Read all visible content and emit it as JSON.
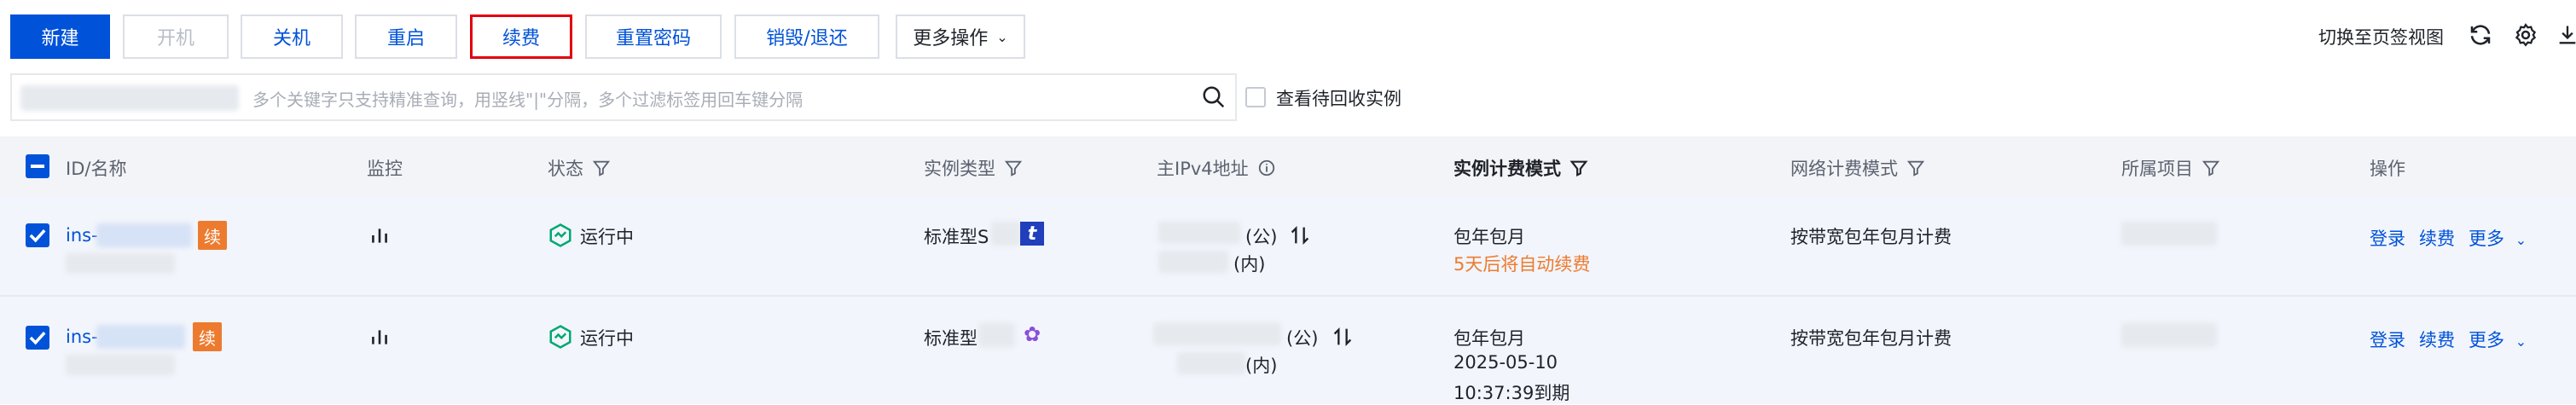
{
  "toolbar": {
    "new": "新建",
    "start": "开机",
    "shutdown": "关机",
    "restart": "重启",
    "renew": "续费",
    "reset_password": "重置密码",
    "terminate": "销毁/退还",
    "more_actions": "更多操作",
    "switch_view": "切换至页签视图"
  },
  "search": {
    "placeholder": "多个关键字只支持精准查询，用竖线\"|\"分隔，多个过滤标签用回车键分隔",
    "recycle_label": "查看待回收实例"
  },
  "table": {
    "headers": {
      "id_name": "ID/名称",
      "monitor": "监控",
      "status": "状态",
      "instance_type": "实例类型",
      "ipv4": "主IPv4地址",
      "billing_mode": "实例计费模式",
      "network_billing": "网络计费模式",
      "project": "所属项目",
      "actions": "操作"
    },
    "rows": [
      {
        "id_prefix": "ins-",
        "badge": "续",
        "status": "运行中",
        "type_prefix": "标准型S",
        "public_suffix": "(公)",
        "private_suffix": "(内)",
        "billing": "包年包月",
        "billing_note": "5天后将自动续费",
        "network": "按带宽包年包月计费",
        "act_login": "登录",
        "act_renew": "续费",
        "act_more": "更多"
      },
      {
        "id_prefix": "ins-",
        "badge": "续",
        "status": "运行中",
        "type_prefix": "标准型",
        "public_suffix": "(公)",
        "private_suffix": "(内)",
        "billing": "包年包月",
        "billing_date": "2025-05-10",
        "billing_expire": "10:37:39到期",
        "network": "按带宽包年包月计费",
        "act_login": "登录",
        "act_renew": "续费",
        "act_more": "更多"
      }
    ]
  },
  "colors": {
    "primary": "#0052d9",
    "highlight_border": "#e3000f",
    "warning": "#ed7b2f",
    "running": "#00a870"
  }
}
